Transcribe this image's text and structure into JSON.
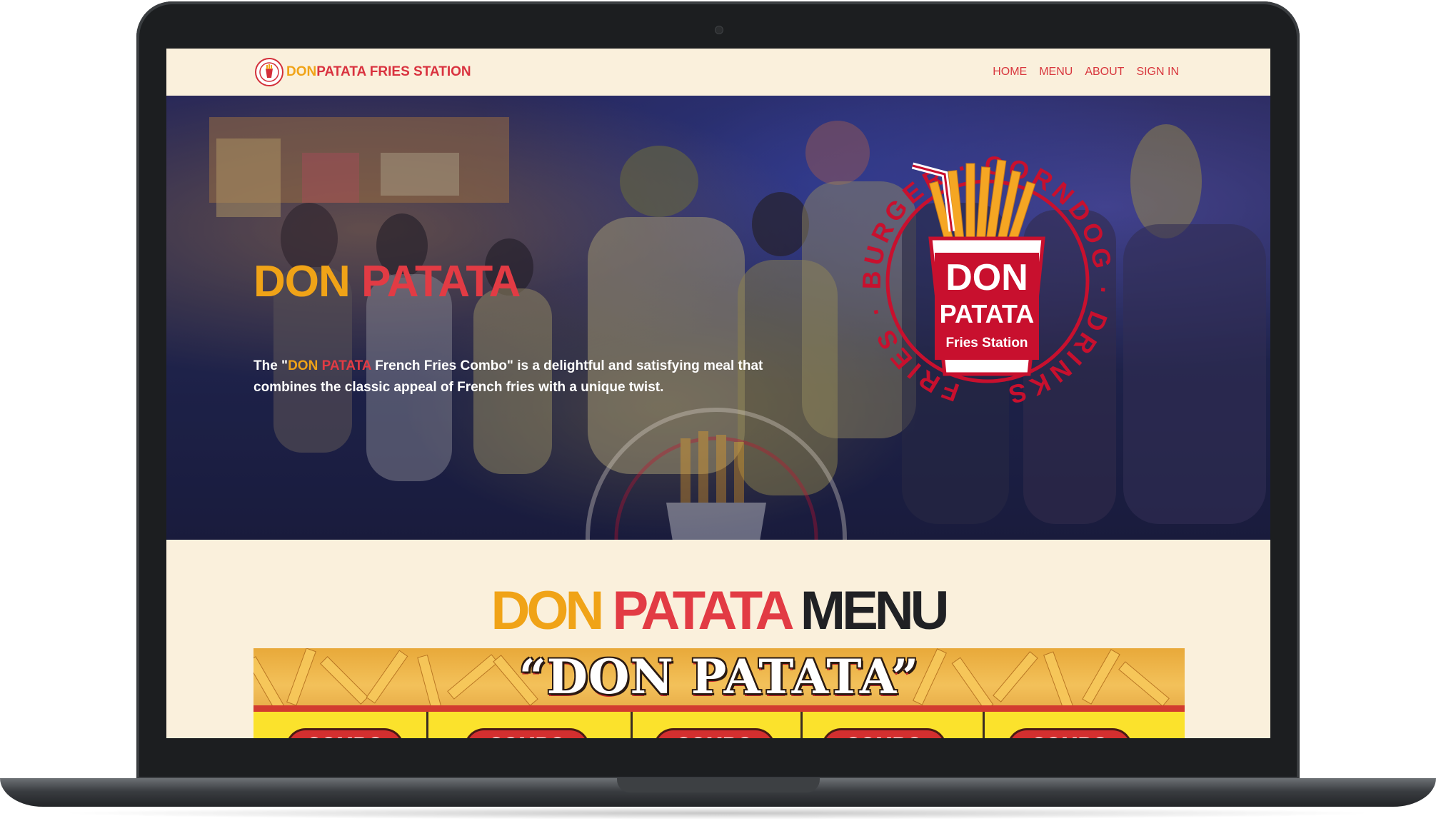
{
  "navbar": {
    "brand_don": "DON",
    "brand_rest": "PATATA FRIES STATION",
    "links": [
      "HOME",
      "MENU",
      "ABOUT",
      "SIGN IN"
    ]
  },
  "hero": {
    "title_don": "DON",
    "title_patata": "PATATA",
    "desc_prefix": "The \"",
    "desc_don": "DON",
    "desc_patata": "PATATA",
    "desc_suffix": " French Fries Combo\" is a delightful and satisfying meal that combines the classic appeal of French fries with a unique twist.",
    "emblem": {
      "cup_line1": "DON",
      "cup_line2": "PATATA",
      "cup_line3": "Fries Station",
      "ring_text": "FRIES · BURGER · CORNDOG · DRINKS"
    }
  },
  "menu": {
    "title_don": "DON",
    "title_patata": "PATATA",
    "title_menu": "MENU",
    "board_title": "“DON  PATATA”",
    "combo_label": "COMBO"
  },
  "colors": {
    "accent_orange": "#f0a317",
    "accent_red": "#e23b44",
    "page_bg": "#faf0dc"
  }
}
